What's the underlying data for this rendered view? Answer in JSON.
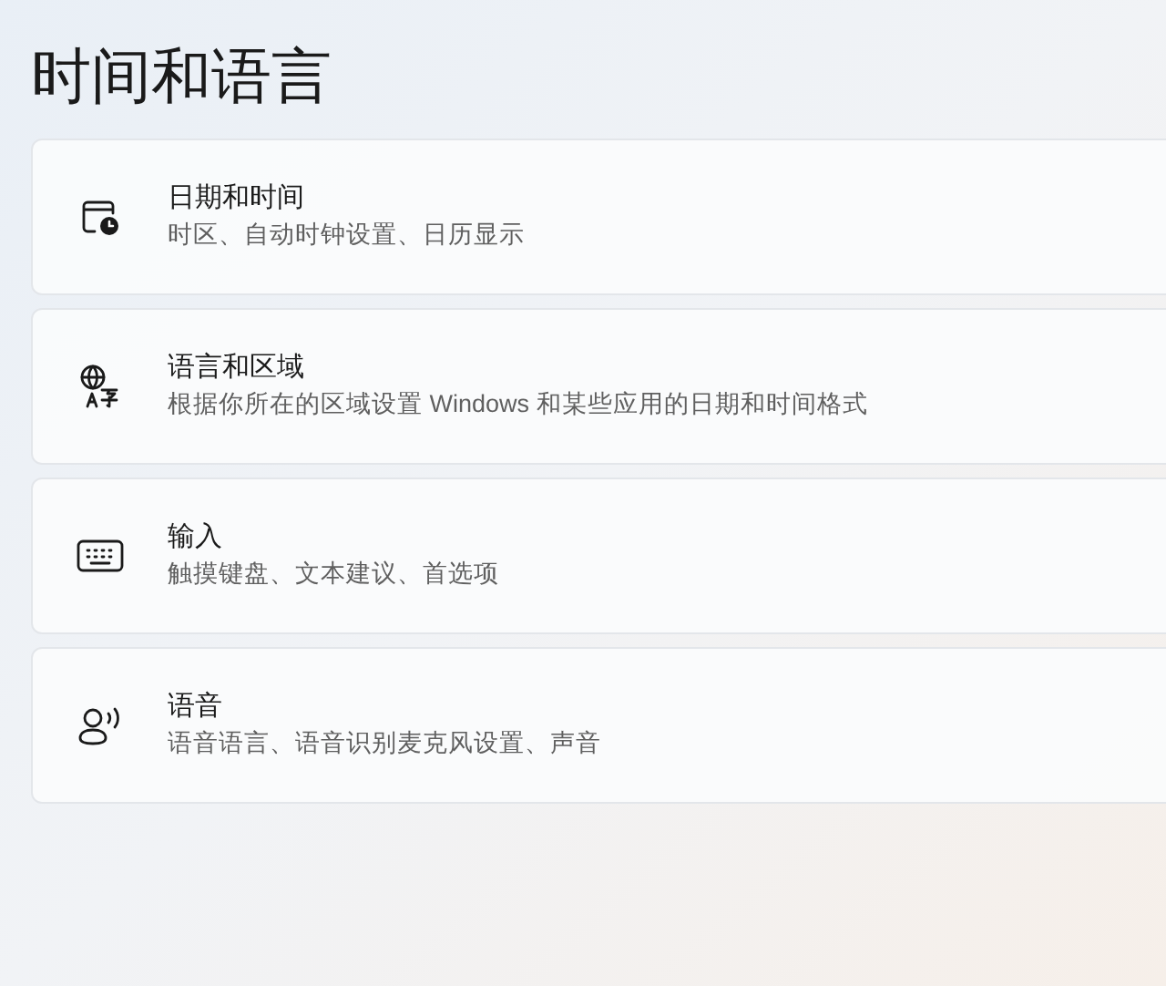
{
  "page": {
    "title": "时间和语言"
  },
  "items": [
    {
      "title": "日期和时间",
      "description": "时区、自动时钟设置、日历显示"
    },
    {
      "title": "语言和区域",
      "description": "根据你所在的区域设置 Windows 和某些应用的日期和时间格式"
    },
    {
      "title": "输入",
      "description": "触摸键盘、文本建议、首选项"
    },
    {
      "title": "语音",
      "description": "语音语言、语音识别麦克风设置、声音"
    }
  ]
}
